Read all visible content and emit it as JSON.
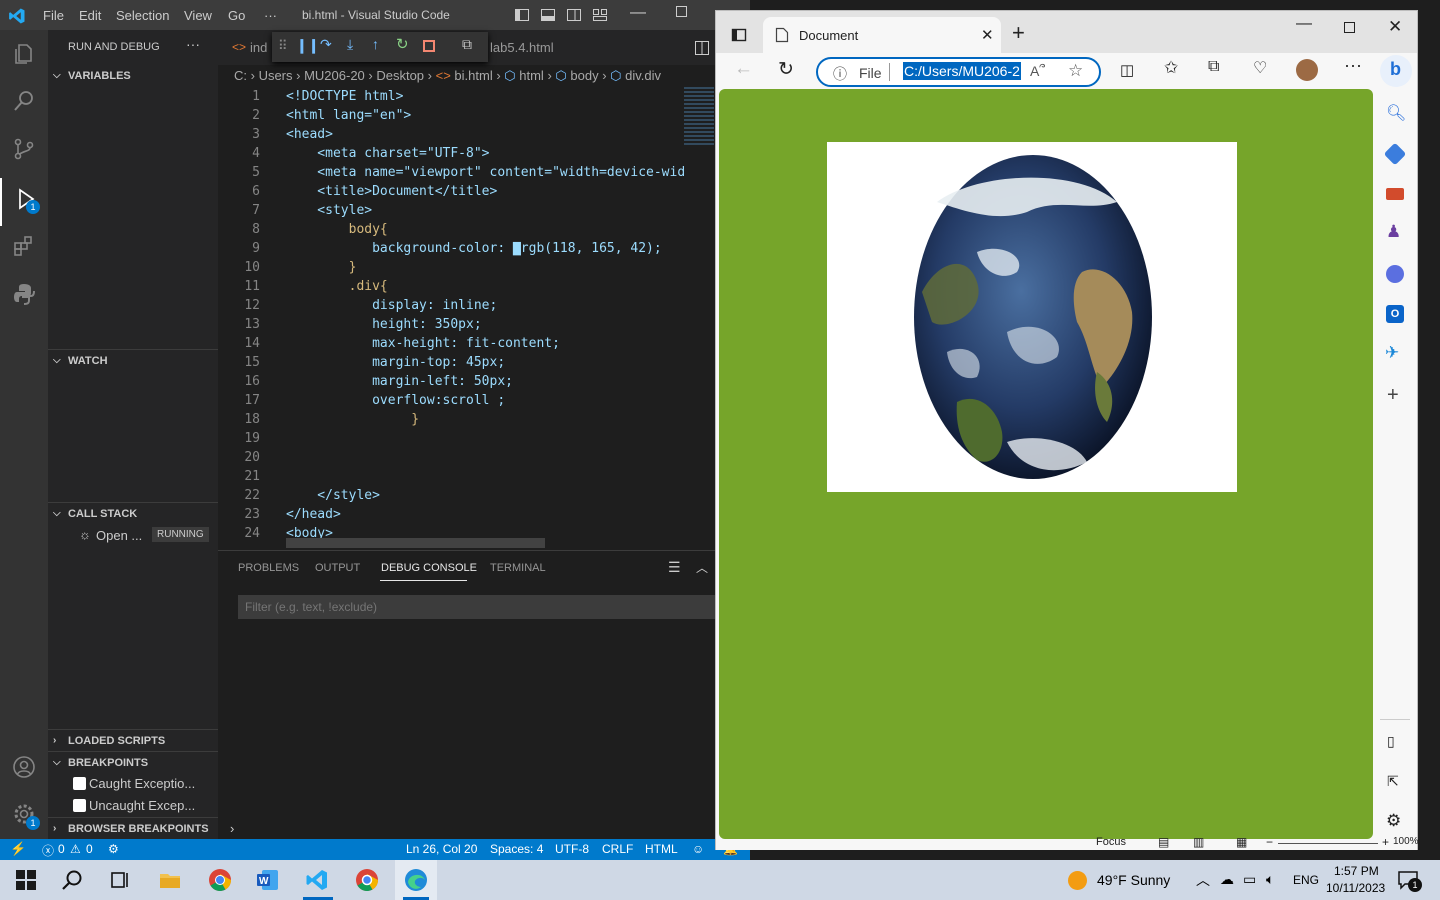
{
  "vscode": {
    "menu": [
      "File",
      "Edit",
      "Selection",
      "View",
      "Go",
      "···"
    ],
    "title": "bi.html - Visual Studio Code",
    "sidebar": {
      "header": "RUN AND DEBUG",
      "more": "···",
      "variables": "VARIABLES",
      "watch": "WATCH",
      "call_stack": "CALL STACK",
      "call_stack_item": "Open ...",
      "call_stack_status": "RUNNING",
      "loaded_scripts": "LOADED SCRIPTS",
      "breakpoints": "BREAKPOINTS",
      "breakpoint_items": [
        "Caught Exceptio...",
        "Uncaught Excep..."
      ],
      "browser_breakpoints": "BROWSER BREAKPOINTS"
    },
    "editor": {
      "tab1": "ind",
      "tab2": "lab5.4.html",
      "breadcrumb": [
        "C:",
        "Users",
        "MU206-20",
        "Desktop",
        "bi.html",
        "html",
        "body",
        "div.div"
      ],
      "lines": [
        {
          "n": "1",
          "t": "<!DOCTYPE html>"
        },
        {
          "n": "2",
          "t": "<html lang=\"en\">"
        },
        {
          "n": "3",
          "t": "<head>"
        },
        {
          "n": "4",
          "t": "    <meta charset=\"UTF-8\">"
        },
        {
          "n": "5",
          "t": "    <meta name=\"viewport\" content=\"width=device-wid"
        },
        {
          "n": "6",
          "t": "    <title>Document</title>"
        },
        {
          "n": "7",
          "t": "    <style>"
        },
        {
          "n": "8",
          "t": "        body{"
        },
        {
          "n": "9",
          "t": "           background-color: ▇rgb(118, 165, 42);"
        },
        {
          "n": "10",
          "t": "        }"
        },
        {
          "n": "11",
          "t": "        .div{"
        },
        {
          "n": "12",
          "t": "           display: inline;"
        },
        {
          "n": "13",
          "t": "           height: 350px;"
        },
        {
          "n": "14",
          "t": "           max-height: fit-content;"
        },
        {
          "n": "15",
          "t": "           margin-top: 45px;"
        },
        {
          "n": "16",
          "t": "           margin-left: 50px;"
        },
        {
          "n": "17",
          "t": "           overflow:scroll ;"
        },
        {
          "n": "18",
          "t": "                }"
        },
        {
          "n": "19",
          "t": ""
        },
        {
          "n": "20",
          "t": ""
        },
        {
          "n": "21",
          "t": ""
        },
        {
          "n": "22",
          "t": "    </style>"
        },
        {
          "n": "23",
          "t": "</head>"
        },
        {
          "n": "24",
          "t": "<body>"
        }
      ]
    },
    "panel": {
      "tabs": [
        "PROBLEMS",
        "OUTPUT",
        "DEBUG CONSOLE",
        "TERMINAL"
      ],
      "filter_placeholder": "Filter (e.g. text, !exclude)"
    },
    "status": {
      "errors": "0",
      "warnings": "0",
      "position": "Ln 26, Col 20",
      "spaces": "Spaces: 4",
      "encoding": "UTF-8",
      "eol": "CRLF",
      "language": "HTML"
    },
    "debug_badge": "1",
    "settings_badge": "1"
  },
  "edge": {
    "tab_title": "Document",
    "file_label": "File",
    "address": "C:/Users/MU206-2",
    "body_color": "#76a52a",
    "zoom": "100%",
    "focus": "Focus"
  },
  "taskbar": {
    "weather": "49°F  Sunny",
    "lang": "ENG",
    "time": "1:57 PM",
    "date": "10/11/2023",
    "notif": "1"
  }
}
